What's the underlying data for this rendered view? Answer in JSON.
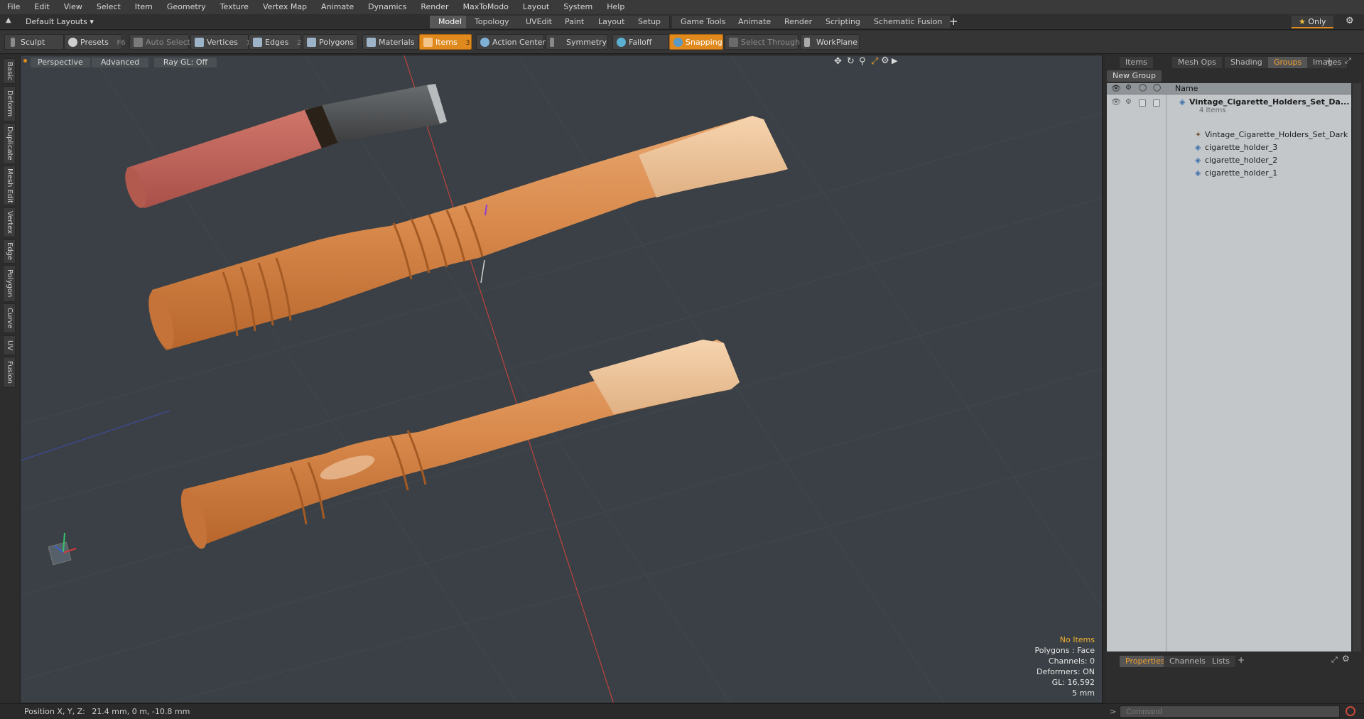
{
  "menu": [
    "File",
    "Edit",
    "View",
    "Select",
    "Item",
    "Geometry",
    "Texture",
    "Vertex Map",
    "Animate",
    "Dynamics",
    "Render",
    "MaxToModo",
    "Layout",
    "System",
    "Help"
  ],
  "layout_selector": "Default Layouts",
  "layout_tabs": [
    {
      "label": "Model",
      "active": true
    },
    {
      "label": "Topology",
      "active": false
    },
    {
      "label": "UVEdit",
      "active": false
    },
    {
      "label": "Paint",
      "active": false
    },
    {
      "label": "Layout",
      "active": false
    },
    {
      "label": "Setup",
      "active": false
    },
    {
      "label": "Game Tools",
      "active": false
    },
    {
      "label": "Animate",
      "active": false
    },
    {
      "label": "Render",
      "active": false
    },
    {
      "label": "Scripting",
      "active": false
    },
    {
      "label": "Schematic Fusion",
      "active": false
    }
  ],
  "only_label": "Only",
  "toolbar": {
    "sculpt": "Sculpt",
    "presets": "Presets",
    "presets_key": "F6",
    "auto_select": "Auto Select",
    "vertices": "Vertices",
    "vertices_count": "1",
    "edges": "Edges",
    "edges_count": "2",
    "polygons": "Polygons",
    "materials": "Materials",
    "items": "Items",
    "items_count": "3",
    "action_center": "Action Center",
    "symmetry": "Symmetry",
    "falloff": "Falloff",
    "snapping": "Snapping",
    "select_through": "Select Through",
    "workplane": "WorkPlane"
  },
  "left_tabs": [
    "Basic",
    "Deform",
    "Duplicate",
    "Mesh Edit",
    "Vertex",
    "Edge",
    "Polygon",
    "Curve",
    "UV",
    "Fusion"
  ],
  "viewport": {
    "view": "Perspective",
    "mode": "Advanced",
    "raygl": "Ray GL: Off",
    "info": {
      "selection": "No Items",
      "polygons": "Polygons : Face",
      "channels": "Channels: 0",
      "deformers": "Deformers: ON",
      "gl": "GL: 16,592",
      "scale": "5 mm"
    }
  },
  "right_panel": {
    "tabs": [
      {
        "label": "Items",
        "active": false
      },
      {
        "label": "Mesh Ops",
        "active": false
      },
      {
        "label": "Shading",
        "active": false
      },
      {
        "label": "Groups",
        "active": true
      },
      {
        "label": "Images",
        "active": false
      }
    ],
    "new_group": "New Group",
    "column_name": "Name",
    "root": "Vintage_Cigarette_Holders_Set_Da...",
    "root_count": "4 Items",
    "children": [
      "Vintage_Cigarette_Holders_Set_Dark",
      "cigarette_holder_3",
      "cigarette_holder_2",
      "cigarette_holder_1"
    ],
    "bottom_tabs": [
      {
        "label": "Properties",
        "active": true
      },
      {
        "label": "Channels",
        "active": false
      },
      {
        "label": "Lists",
        "active": false
      }
    ]
  },
  "status": {
    "position_label": "Position X, Y, Z:",
    "position_value": "21.4 mm, 0 m, -10.8 mm",
    "command_placeholder": "Command"
  },
  "colors": {
    "accent_orange": "#e08a1e",
    "viewport_bg": "#3a4045",
    "wood_light": "#e8b888",
    "wood_dark": "#c9793f",
    "reddish_wood": "#b86456",
    "dark_mouthpiece": "#55585a"
  }
}
